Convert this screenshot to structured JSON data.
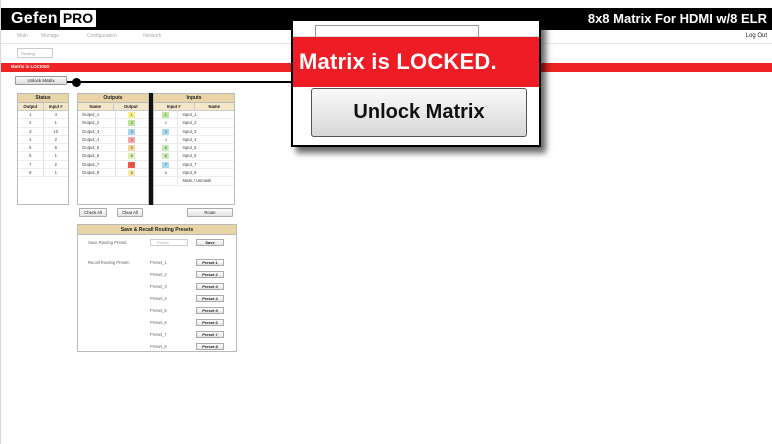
{
  "header": {
    "logo_main": "Gefen",
    "logo_pro": "PRO",
    "device_title": "8x8 Matrix For HDMI w/8 ELR"
  },
  "nav": {
    "items": [
      "Main",
      "Manage",
      "Configuration",
      "Network"
    ],
    "logout": "Log Out",
    "subtab": "Routing"
  },
  "banner": {
    "text": "Matrix is LOCKED"
  },
  "toolbar": {
    "unlock_small_label": "Unlock Matrix"
  },
  "status": {
    "title": "Status",
    "columns": [
      "Output",
      "Input #"
    ],
    "rows": [
      [
        "1",
        "4"
      ],
      [
        "2",
        "1"
      ],
      [
        "3",
        "10"
      ],
      [
        "4",
        "2"
      ],
      [
        "5",
        "6"
      ],
      [
        "6",
        "1"
      ],
      [
        "7",
        "2"
      ],
      [
        "8",
        "1"
      ]
    ]
  },
  "outputs": {
    "title": "Outputs",
    "columns": [
      "Name",
      "Output"
    ],
    "rows": [
      {
        "name": "Output_1",
        "num": "1",
        "color": "#f7f08a"
      },
      {
        "name": "Output_2",
        "num": "2",
        "color": "#bfe6a0"
      },
      {
        "name": "Output_3",
        "num": "3",
        "color": "#a8d8f0"
      },
      {
        "name": "Output_4",
        "num": "4",
        "color": "#f7a8a8"
      },
      {
        "name": "Output_5",
        "num": "5",
        "color": "#f7d9a0"
      },
      {
        "name": "Output_6",
        "num": "6",
        "color": "#d6f0b0"
      },
      {
        "name": "Output_7",
        "num": "7",
        "color": "#ee5a4a"
      },
      {
        "name": "Output_8",
        "num": "8",
        "color": "#f7e7a8"
      }
    ]
  },
  "inputs": {
    "title": "Inputs",
    "columns": [
      "Input #",
      "Name"
    ],
    "rows": [
      {
        "num": "1",
        "name": "Input_1",
        "color": "#bfe6a0"
      },
      {
        "num": "2",
        "name": "Input_2",
        "color": "#ffffff"
      },
      {
        "num": "3",
        "name": "Input_3",
        "color": "#a8d8f0"
      },
      {
        "num": "4",
        "name": "Input_4",
        "color": "#ffffff"
      },
      {
        "num": "5",
        "name": "Input_5",
        "color": "#c8ecb8"
      },
      {
        "num": "6",
        "name": "Input_6",
        "color": "#c8ecb8"
      },
      {
        "num": "7",
        "name": "Input_7",
        "color": "#a8d8f0"
      },
      {
        "num": "8",
        "name": "Input_8",
        "color": "#ffffff"
      },
      {
        "num": "",
        "name": "Mask / Unmask",
        "color": "#ffffff"
      }
    ]
  },
  "actions": {
    "check_all": "Check All",
    "clear_all": "Clear All",
    "route": "Route"
  },
  "presets": {
    "title": "Save & Recall Routing Presets",
    "save_label": "Save Routing Preset:",
    "save_placeholder": "Preset",
    "save_button": "Save",
    "recall_label": "Recall Routing Preset:",
    "items": [
      {
        "name": "Preset_1",
        "button": "Preset 1"
      },
      {
        "name": "Preset_2",
        "button": "Preset 2"
      },
      {
        "name": "Preset_3",
        "button": "Preset 3"
      },
      {
        "name": "Preset_4",
        "button": "Preset 4"
      },
      {
        "name": "Preset_5",
        "button": "Preset 5"
      },
      {
        "name": "Preset_6",
        "button": "Preset 6"
      },
      {
        "name": "Preset_7",
        "button": "Preset 7"
      },
      {
        "name": "Preset_8",
        "button": "Preset 8"
      }
    ]
  },
  "popup": {
    "message": "Matrix is LOCKED.",
    "button": "Unlock Matrix"
  }
}
